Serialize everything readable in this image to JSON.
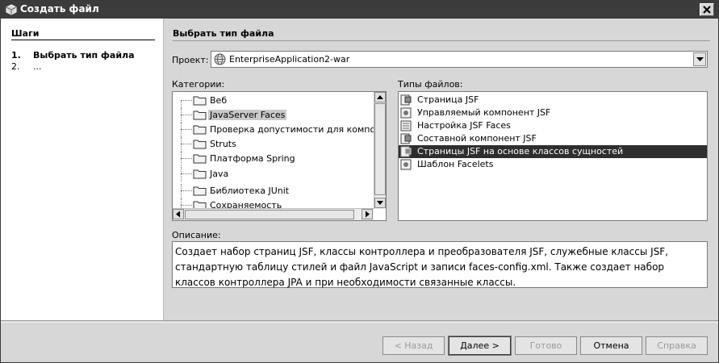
{
  "window": {
    "title": "Создать файл"
  },
  "steps": {
    "heading": "Шаги",
    "items": [
      {
        "num": "1.",
        "label": "Выбрать тип файла"
      },
      {
        "num": "2.",
        "label": "..."
      }
    ]
  },
  "content": {
    "heading": "Выбрать тип файла",
    "project_label": "Проект:",
    "project_value": "EnterpriseApplication2-war",
    "categories_label": "Категории:",
    "file_types_label": "Типы файлов:",
    "categories": [
      "Веб",
      "JavaServer Faces",
      "Проверка допустимости для компонент",
      "Struts",
      "Платформа Spring",
      "Java",
      "Библиотека JUnit",
      "Сохраняемость"
    ],
    "selected_category": "JavaServer Faces",
    "file_types": [
      "Страница JSF",
      "Управляемый компонент JSF",
      "Настройка JSF Faces",
      "Составной компонент JSF",
      "Страницы JSF на основе классов сущностей",
      "Шаблон Facelets"
    ],
    "selected_file_type": "Страницы JSF на основе классов сущностей",
    "description_label": "Описание:",
    "description": "Создает набор страниц JSF, классы контроллера и преобразователя JSF, служебные классы JSF, стандартную таблицу стилей и файл JavaScript и записи faces-config.xml. Также создает набор классов контроллера JPA и при необходимости связанные классы."
  },
  "buttons": {
    "back": "< Назад",
    "next": "Далее >",
    "finish": "Готово",
    "cancel": "Отмена",
    "help": "Справка"
  },
  "icons": {
    "window": "netbeans-cube-icon",
    "project": "globe-icon",
    "category": "folder-icon",
    "file_type": "jsf-file-icon"
  }
}
